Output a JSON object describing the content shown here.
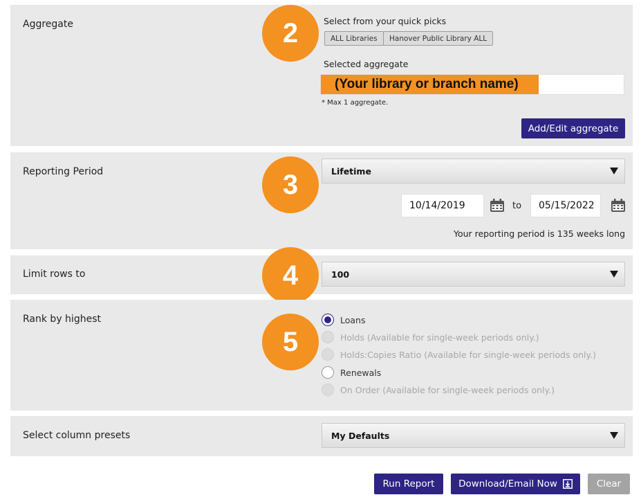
{
  "aggregate": {
    "label": "Aggregate",
    "step": "2",
    "quick_picks_label": "Select from your quick picks",
    "quick_picks": [
      "ALL Libraries",
      "Hanover Public Library ALL"
    ],
    "selected_label": "Selected aggregate",
    "selected_value": "(Your library or branch name)",
    "note": "* Max 1 aggregate.",
    "edit_button": "Add/Edit aggregate"
  },
  "reporting_period": {
    "label": "Reporting Period",
    "step": "3",
    "selected": "Lifetime",
    "from_date": "10/14/2019",
    "to_label": "to",
    "to_date": "05/15/2022",
    "summary": "Your reporting period is 135 weeks long"
  },
  "limit_rows": {
    "label": "Limit rows to",
    "step": "4",
    "selected": "100"
  },
  "rank": {
    "label": "Rank by highest",
    "step": "5",
    "options": [
      {
        "label": "Loans",
        "checked": true,
        "disabled": false
      },
      {
        "label": "Holds (Available for single-week periods only.)",
        "checked": false,
        "disabled": true
      },
      {
        "label": "Holds:Copies Ratio (Available for single-week periods only.)",
        "checked": false,
        "disabled": true
      },
      {
        "label": "Renewals",
        "checked": false,
        "disabled": false
      },
      {
        "label": "On Order (Available for single-week periods only.)",
        "checked": false,
        "disabled": true
      }
    ]
  },
  "column_presets": {
    "label": "Select column presets",
    "selected": "My Defaults"
  },
  "actions": {
    "run": "Run Report",
    "download": "Download/Email Now",
    "clear": "Clear"
  },
  "colors": {
    "accent": "#2d2483",
    "badge": "#f39121",
    "section_bg": "#e9e9e9",
    "clear_button": "#a4a4a4"
  }
}
